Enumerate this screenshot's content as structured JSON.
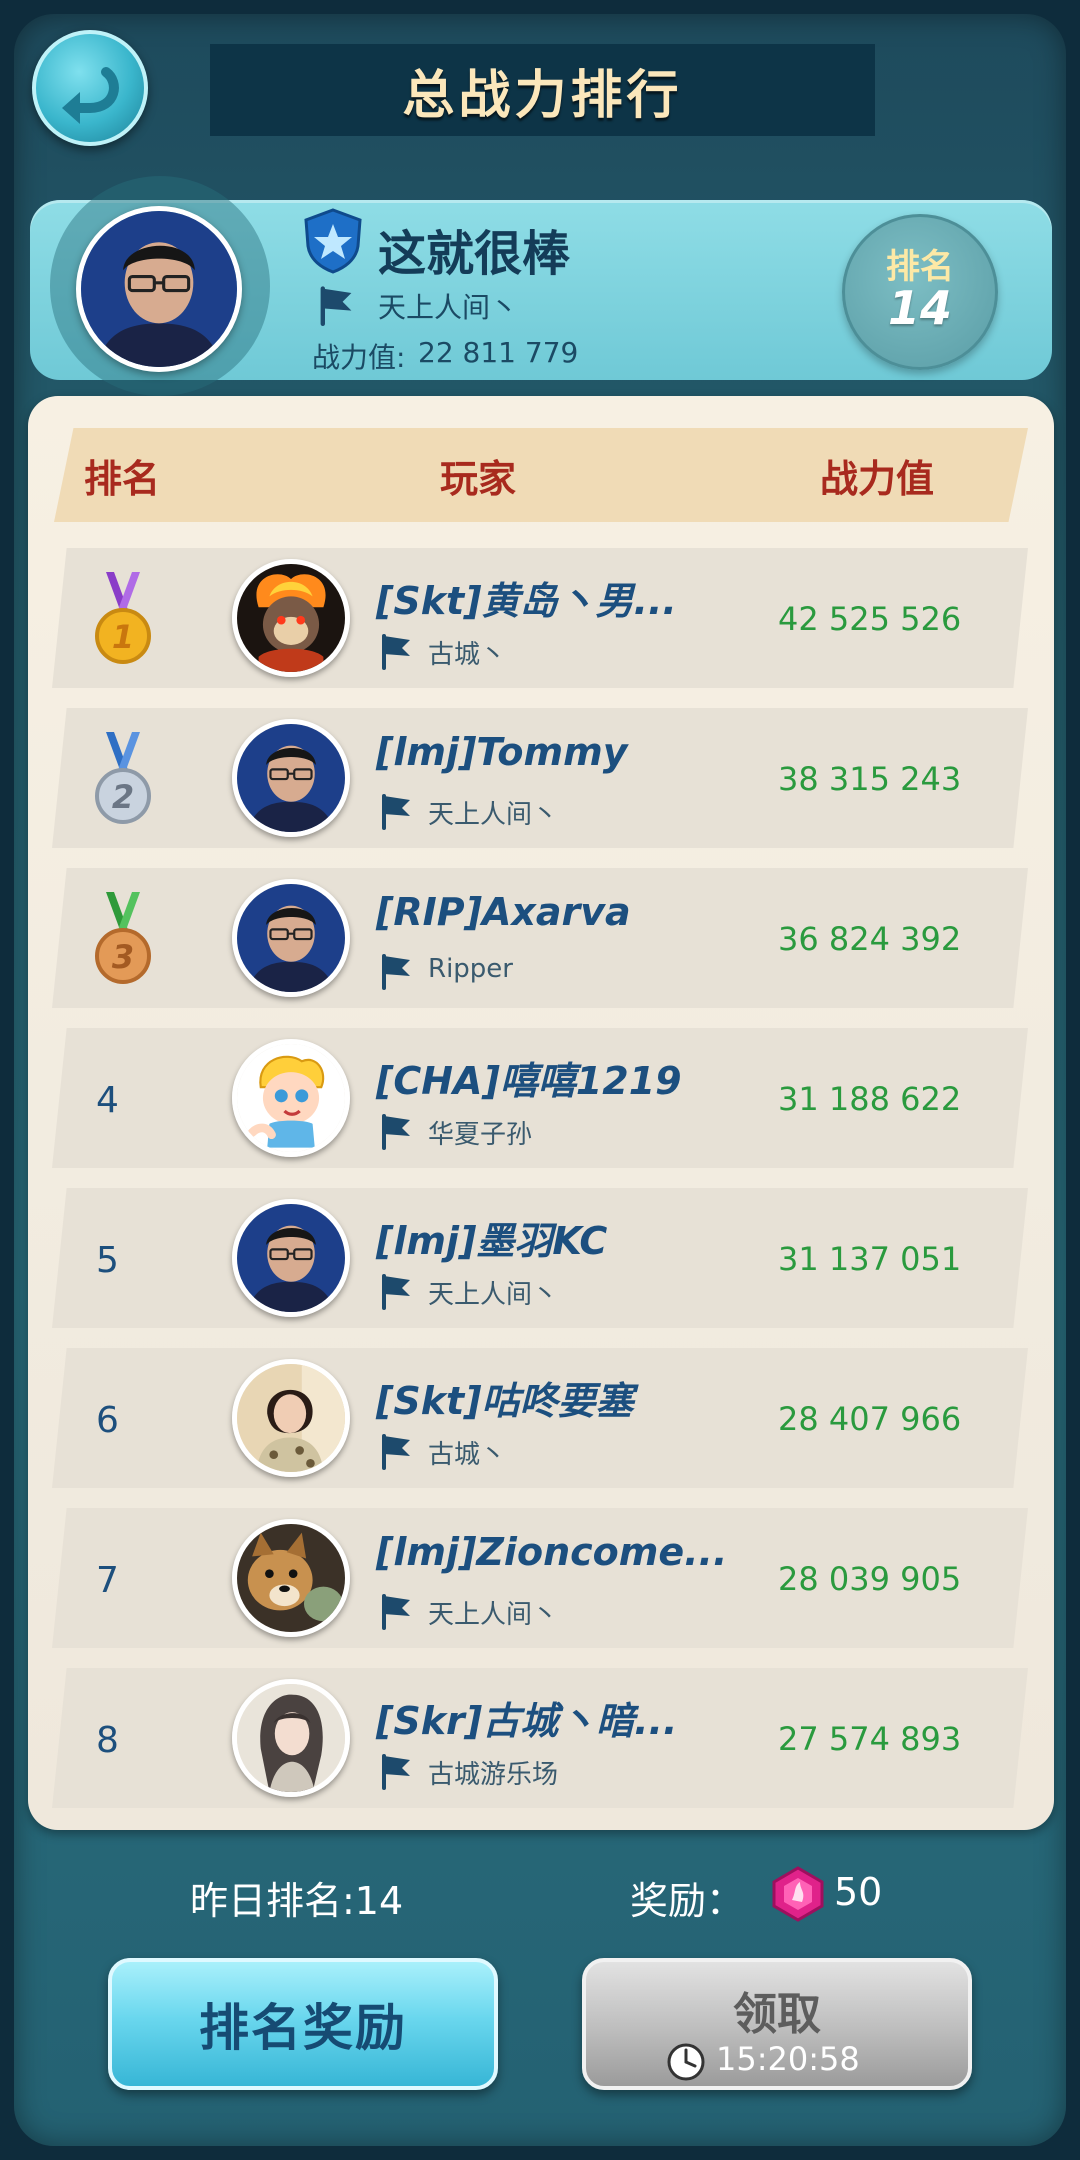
{
  "header": {
    "title": "总战力排行"
  },
  "me": {
    "name": "这就很棒",
    "guild": "天上人间丶",
    "power_label": "战力值:",
    "power_value": "22 811 779",
    "rank_label": "排名",
    "rank_value": "14"
  },
  "columns": {
    "rank": "排名",
    "player": "玩家",
    "power": "战力值"
  },
  "rows": [
    {
      "rank": "1",
      "name": "[Skt]黄岛丶男...",
      "guild": "古城丶",
      "power": "42 525 526",
      "medal": "gold-medal-icon"
    },
    {
      "rank": "2",
      "name": "[lmj]Tommy",
      "guild": "天上人间丶",
      "power": "38 315 243",
      "medal": "silver-medal-icon"
    },
    {
      "rank": "3",
      "name": "[RIP]Axarva",
      "guild": "Ripper",
      "power": "36 824 392",
      "medal": "bronze-medal-icon"
    },
    {
      "rank": "4",
      "name": "[CHA]嘻嘻1219",
      "guild": "华夏子孙",
      "power": "31 188 622"
    },
    {
      "rank": "5",
      "name": "[lmj]墨羽KC",
      "guild": "天上人间丶",
      "power": "31 137 051"
    },
    {
      "rank": "6",
      "name": "[Skt]咕咚要塞",
      "guild": "古城丶",
      "power": "28 407 966"
    },
    {
      "rank": "7",
      "name": "[lmj]Zioncome...",
      "guild": "天上人间丶",
      "power": "28 039 905"
    },
    {
      "rank": "8",
      "name": "[Skr]古城丶暗...",
      "guild": "古城游乐场",
      "power": "27 574 893"
    }
  ],
  "footer": {
    "yesterday_rank": "昨日排名:14",
    "reward_label": "奖励：",
    "reward_value": "50",
    "rank_reward_button": "排名奖励",
    "claim_button": "领取",
    "claim_timer": "15:20:58"
  },
  "colors": {
    "title": "#fbe7bb",
    "header_red": "#a82a1e",
    "power_green": "#2a9a3e",
    "name_blue": "#1c4f7f",
    "gem": "#e0228a"
  }
}
